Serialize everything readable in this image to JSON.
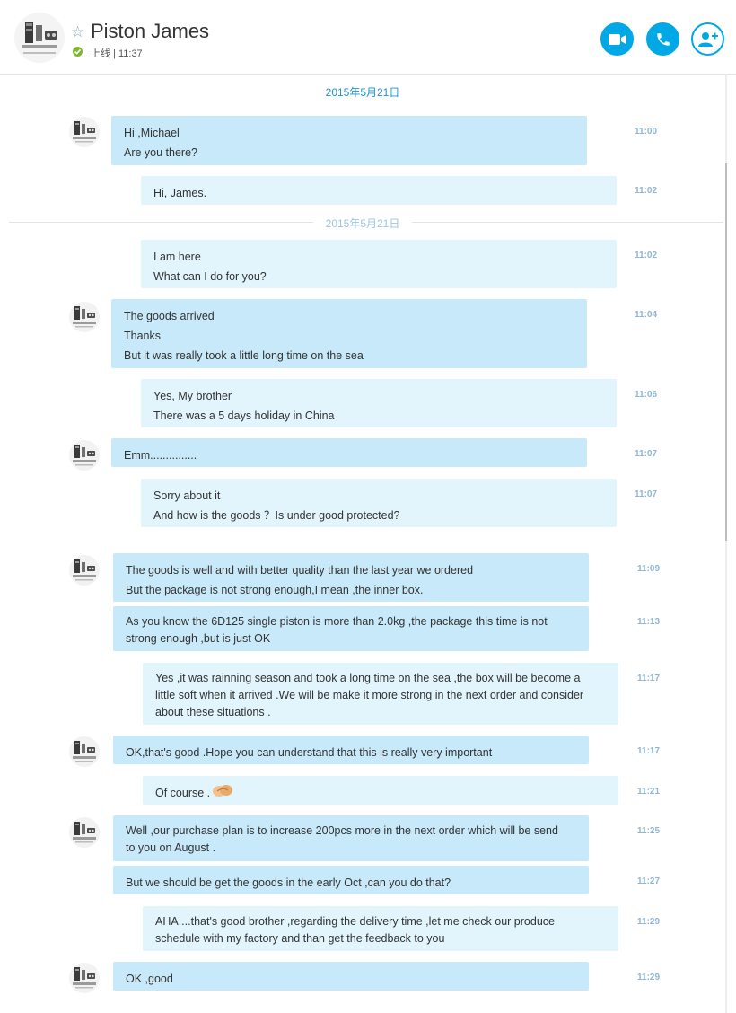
{
  "conversation": {
    "contact_name": "Piston James",
    "status": "上线 | 11:37",
    "date_separator": "2015年5月21日",
    "date_separator_2": "2015年5月21日"
  },
  "icons": {
    "favorite": "star-icon",
    "presence": "online-check-icon",
    "video": "video-camera-icon",
    "call": "phone-icon",
    "add_contact": "add-person-icon",
    "emoticon": "handshake-icon"
  },
  "colors": {
    "accent": "#00a8e6",
    "incoming_bubble": "#c8e9f9",
    "outgoing_bubble": "#e2f4fc",
    "timestamp": "#8fb6d3",
    "online": "#7cb82f"
  },
  "messages": [
    {
      "dir": "in",
      "lines": [
        "Hi ,Michael",
        "Are you there?"
      ],
      "time": "11:00"
    },
    {
      "dir": "out",
      "lines": [
        "Hi, James."
      ],
      "time": "11:02"
    },
    {
      "dir": "out",
      "lines": [
        "I am here",
        "What can I do for you?"
      ],
      "time": "11:02"
    },
    {
      "dir": "in",
      "lines": [
        "The goods arrived",
        "Thanks",
        "But it was really took a little long time on the sea"
      ],
      "time": "11:04"
    },
    {
      "dir": "out",
      "lines": [
        "Yes, My brother",
        "There was a 5 days holiday in China"
      ],
      "time": "11:06"
    },
    {
      "dir": "in",
      "lines": [
        "Emm..............."
      ],
      "time": "11:07"
    },
    {
      "dir": "out",
      "lines": [
        "Sorry about it",
        "And how is the goods ？Is under good protected?"
      ],
      "time": "11:07"
    },
    {
      "dir": "in",
      "lines": [
        "The goods is well and with better quality than the last year we ordered",
        "But the package is not strong enough,I mean ,the inner box."
      ],
      "time": "11:09"
    },
    {
      "dir": "in",
      "lines": [
        "As you know the 6D125 single piston is more than 2.0kg ,the package this time is not",
        "strong enough ,but is just OK"
      ],
      "time": "11:13"
    },
    {
      "dir": "out",
      "lines": [
        "Yes ,it was rainning season and took a long time on the sea ,the box will be become a",
        "little soft when it arrived .We will be make it more strong in the next order and consider",
        "about these situations ."
      ],
      "time": "11:17"
    },
    {
      "dir": "in",
      "lines": [
        "OK,that's good .Hope you can understand that this is really very important"
      ],
      "time": "11:17"
    },
    {
      "dir": "out",
      "lines": [
        "Of course ."
      ],
      "time": "11:21"
    },
    {
      "dir": "in",
      "lines": [
        "Well ,our purchase plan is to increase 200pcs more in the next order which will be send",
        "to you on August ."
      ],
      "time": "11:25"
    },
    {
      "dir": "in",
      "lines": [
        "But we should be get the goods in the early Oct ,can you do that?"
      ],
      "time": "11:27"
    },
    {
      "dir": "out",
      "lines": [
        "AHA....that's good brother ,regarding the delivery time ,let me check our produce",
        "schedule with my factory and than get the feedback to you"
      ],
      "time": "11:29"
    },
    {
      "dir": "in",
      "lines": [
        "OK ,good"
      ],
      "time": "11:29"
    }
  ]
}
